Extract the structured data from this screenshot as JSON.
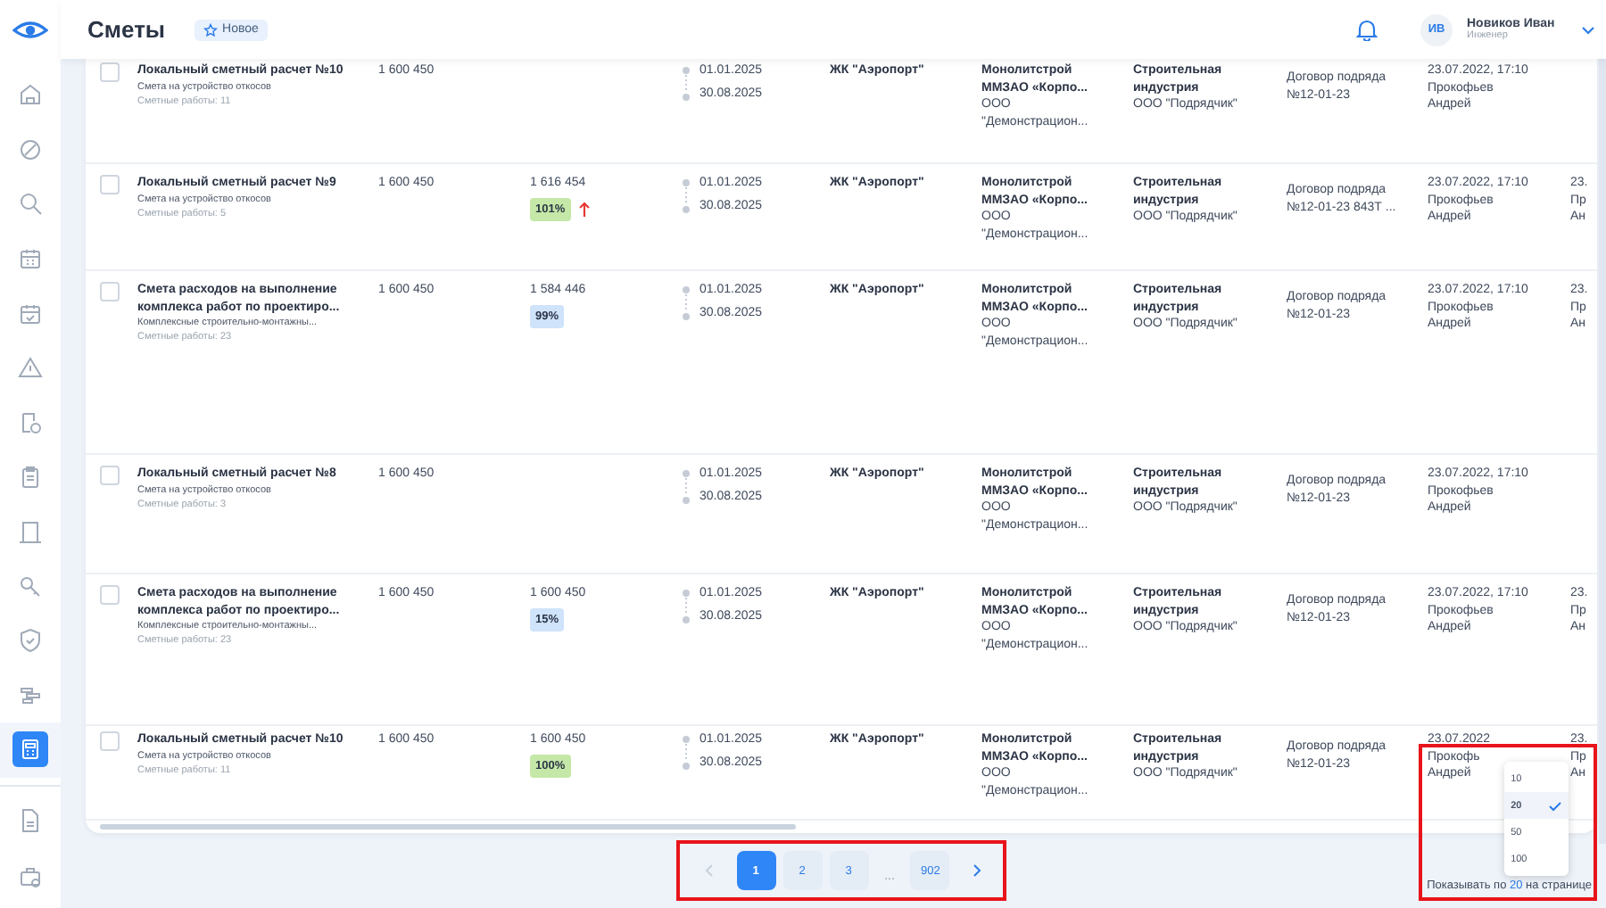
{
  "header": {
    "title": "Сметы",
    "badge": "Новое",
    "user": {
      "initials": "ИВ",
      "name": "Новиков Иван",
      "role": "Инженер"
    }
  },
  "sidebar": {
    "items": [
      {
        "selected": false
      },
      {
        "selected": false
      },
      {
        "selected": false
      },
      {
        "selected": false
      },
      {
        "selected": false
      },
      {
        "selected": false
      },
      {
        "selected": false
      },
      {
        "selected": false
      },
      {
        "selected": false
      },
      {
        "selected": false
      },
      {
        "selected": false
      },
      {
        "selected": false
      },
      {
        "selected": true
      }
    ],
    "bottom_items": [
      {
        "selected": false
      },
      {
        "selected": false
      }
    ]
  },
  "rows": [
    {
      "checked": false,
      "name": "Локальный сметный расчет №10",
      "subtitle": "Смета на устройство откосов",
      "works": "Сметные работы: 11",
      "sum": "1 600 450",
      "start": "01.01.2025",
      "end": "30.08.2025",
      "object": "ЖК \"Аэропорт\"",
      "customer": "Монолитстрой ММЗАО «Корпо...",
      "customer_org": "ООО \"Демонстрацион...",
      "contractor": "Строительная индустрия",
      "contractor_org": "ООО \"Подрядчик\"",
      "contract": "Договор подряда №12-01-23",
      "updated": "23.07.2022, 17:10",
      "author": "Прокофьев Андрей"
    },
    {
      "checked": false,
      "name": "Локальный сметный расчет №9",
      "subtitle": "Смета на устройство откосов",
      "works": "Сметные работы: 5",
      "sum": "1 600 450",
      "actual": "1 616 454",
      "percent": "101%",
      "color": "#c5e8a8",
      "trend_up": true,
      "start": "01.01.2025",
      "end": "30.08.2025",
      "object": "ЖК \"Аэропорт\"",
      "customer": "Монолитстрой ММЗАО «Корпо...",
      "customer_org": "ООО \"Демонстрацион...",
      "contractor": "Строительная индустрия",
      "contractor_org": "ООО \"Подрядчик\"",
      "contract": "Договор подряда №12-01-23 843Т ...",
      "updated": "23.07.2022, 17:10",
      "author": "Прокофьев Андрей",
      "column_10": [
        "23.",
        "Пр",
        "Ан"
      ]
    },
    {
      "checked": false,
      "name": "Смета расходов на выполнение комплекса работ по проектиро...",
      "subtitle": "Комплексные строительно-монтажны...",
      "works": "Сметные работы: 23",
      "sum": "1 600 450",
      "actual": "1 584 446",
      "percent": "99%",
      "color": "#cfe3fb",
      "trend_up": false,
      "start": "01.01.2025",
      "end": "30.08.2025",
      "object": "ЖК \"Аэропорт\"",
      "customer": "Монолитстрой ММЗАО «Корпо...",
      "customer_org": "ООО \"Демонстрацион...",
      "contractor": "Строительная индустрия",
      "contractor_org": "ООО \"Подрядчик\"",
      "contract": "Договор подряда №12-01-23",
      "updated": "23.07.2022, 17:10",
      "author": "Прокофьев Андрей",
      "column_10": [
        "23.",
        "Пр",
        "Ан"
      ]
    },
    {
      "checked": false,
      "name": "Локальный сметный расчет №8",
      "subtitle": "Смета на устройство откосов",
      "works": "Сметные работы: 3",
      "sum": "1 600 450",
      "start": "01.01.2025",
      "end": "30.08.2025",
      "object": "ЖК \"Аэропорт\"",
      "customer": "Монолитстрой ММЗАО «Корпо...",
      "customer_org": "ООО \"Демонстрацион...",
      "contractor": "Строительная индустрия",
      "contractor_org": "ООО \"Подрядчик\"",
      "contract": "Договор подряда №12-01-23",
      "updated": "23.07.2022, 17:10",
      "author": "Прокофьев Андрей"
    },
    {
      "checked": false,
      "name": "Смета расходов на выполнение комплекса работ по проектиро...",
      "subtitle": "Комплексные строительно-монтажны...",
      "works": "Сметные работы: 23",
      "sum": "1 600 450",
      "actual": "1 600 450",
      "percent": "15%",
      "color": "#cfe3fb",
      "trend_up": false,
      "start": "01.01.2025",
      "end": "30.08.2025",
      "object": "ЖК \"Аэропорт\"",
      "customer": "Монолитстрой ММЗАО «Корпо...",
      "customer_org": "ООО \"Демонстрацион...",
      "contractor": "Строительная индустрия",
      "contractor_org": "ООО \"Подрядчик\"",
      "contract": "Договор подряда №12-01-23",
      "updated": "23.07.2022, 17:10",
      "author": "Прокофьев Андрей",
      "column_10": [
        "23.",
        "Пр",
        "Ан"
      ]
    },
    {
      "checked": false,
      "name": "Локальный сметный расчет №10",
      "subtitle": "Смета на устройство откосов",
      "works": "Сметные работы: 11",
      "sum": "1 600 450",
      "actual": "1 600 450",
      "percent": "100%",
      "color": "#c5e8a8",
      "trend_up": false,
      "start": "01.01.2025",
      "end": "30.08.2025",
      "object": "ЖК \"Аэропорт\"",
      "customer": "Монолитстрой ММЗАО «Корпо...",
      "customer_org": "ООО \"Демонстрацион...",
      "contractor": "Строительная индустрия",
      "contractor_org": "ООО \"Подрядчик\"",
      "contract": "Договор подряда №12-01-23",
      "updated": "23.07.2022",
      "author": "Прокофь Андрей",
      "column_10": [
        "23.",
        "Пр",
        "Ан"
      ]
    }
  ],
  "pagination": {
    "highlighted": true,
    "prev_disabled": true,
    "pages": [
      {
        "label": "1",
        "selected": true
      },
      {
        "label": "2",
        "selected": false
      },
      {
        "label": "3",
        "selected": false
      },
      {
        "label": "...",
        "kind": "gap"
      },
      {
        "label": "902",
        "selected": false
      }
    ]
  },
  "per_page": {
    "highlighted": true,
    "prefix": "Показывать по",
    "value": "20",
    "suffix": "на странице",
    "options": [
      {
        "label": "10",
        "selected": false
      },
      {
        "label": "20",
        "selected": true
      },
      {
        "label": "50",
        "selected": false
      },
      {
        "label": "100",
        "selected": false
      }
    ]
  }
}
